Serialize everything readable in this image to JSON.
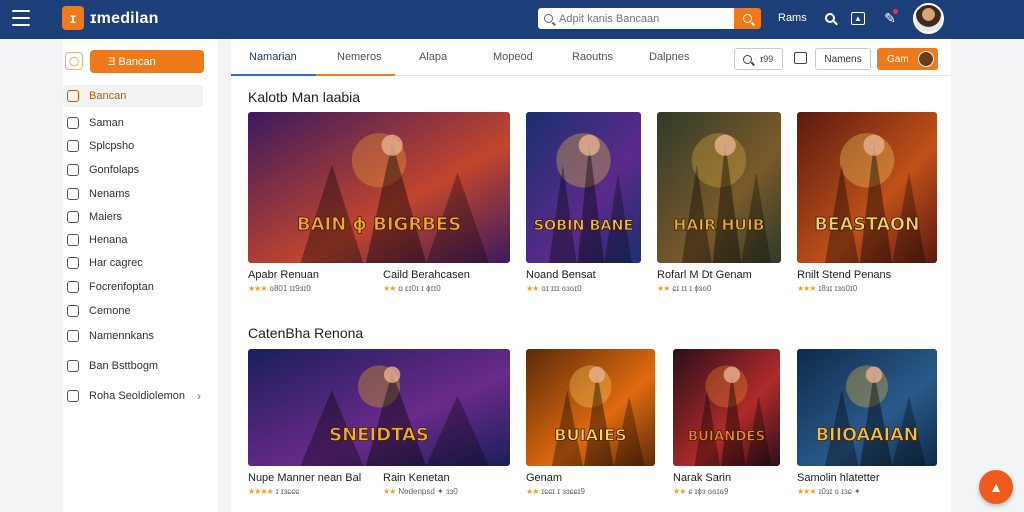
{
  "header": {
    "logo_text": "ɪmedilan",
    "search_placeholder": "Adpit kanis Bancaan",
    "link": "Rams"
  },
  "sidebar": {
    "cta_label": "Ǝ Bancan",
    "items": [
      {
        "label": "Bancan",
        "active": true
      },
      {
        "label": "Saman"
      },
      {
        "label": "Splcpsho"
      },
      {
        "label": "Gonfolaps"
      },
      {
        "label": "Nenams"
      },
      {
        "label": "Maiers"
      },
      {
        "label": "Henana"
      },
      {
        "label": "Har cagrec"
      },
      {
        "label": "Focrenfoptan"
      },
      {
        "label": "Cemone"
      },
      {
        "label": "Namennkans"
      },
      {
        "label": "Ban Bsttbogm"
      },
      {
        "label": "Roha Seoldiolemon"
      }
    ]
  },
  "tabs": [
    "Namarian",
    "Nemeros",
    "Alapa",
    "Mopeod",
    "Raoutns",
    "Dalpnes"
  ],
  "toolbar": {
    "search_label": "ɪ99",
    "button_label": "Namens",
    "orange_label": "Gam"
  },
  "sections": [
    {
      "title": "Kalotb Man laabia",
      "cards": [
        {
          "title": "Apabr Renuan",
          "meta": "ɢ801 ɪɪ9ɜɪ0",
          "stars": "★★★"
        },
        {
          "title": "Caild Berahcasen",
          "meta": "ɑ ɛɪ0ɪ ɪ ɸɪɪ0",
          "stars": "★★"
        },
        {
          "title": "Noand Bensat",
          "meta": "ɢɪ ɪɪɪ ɢɜɢɪ0",
          "stars": "★★"
        },
        {
          "title": "Rofarl M Dt Genam",
          "meta": "ɕɪ ɪɪ ɪ ɸɜɢ0",
          "stars": "★★"
        },
        {
          "title": "Rnilt Stend Penans",
          "meta": "ɪ8ɜɪ ɪɜɢ0ɪ0",
          "stars": "★★★"
        }
      ]
    },
    {
      "title": "CatenBha Renona",
      "cards": [
        {
          "title": "Nupe Manner nean Bal",
          "meta": "ɪ ɪɜɕɕɕ",
          "stars": "★★★★"
        },
        {
          "title": "Rain Kenetan",
          "meta": "Nodenpsd ✦ ɜɜ0",
          "stars": "★★"
        },
        {
          "title": "Genam",
          "meta": "ɪɕɕɪ ɪ ɜɜɕɕɪ9",
          "stars": "★★"
        },
        {
          "title": "Narak Sarin",
          "meta": "ɕ ɪɸɜ ɢɢɪɢ9",
          "stars": "★★"
        },
        {
          "title": "Samolin hlatetter",
          "meta": "ɪ0ɜɪ ɢ ɪɜɕ ✦",
          "stars": "★★★"
        }
      ]
    }
  ],
  "thumb_art": [
    "BAIN ɸ BIGRBES",
    "SOBIN BANE",
    "HAIR HUIB",
    "BEASTAON",
    "SNEIDTAS",
    "BUIAIES",
    "BUIANDES",
    "BIIOAAIAN"
  ]
}
